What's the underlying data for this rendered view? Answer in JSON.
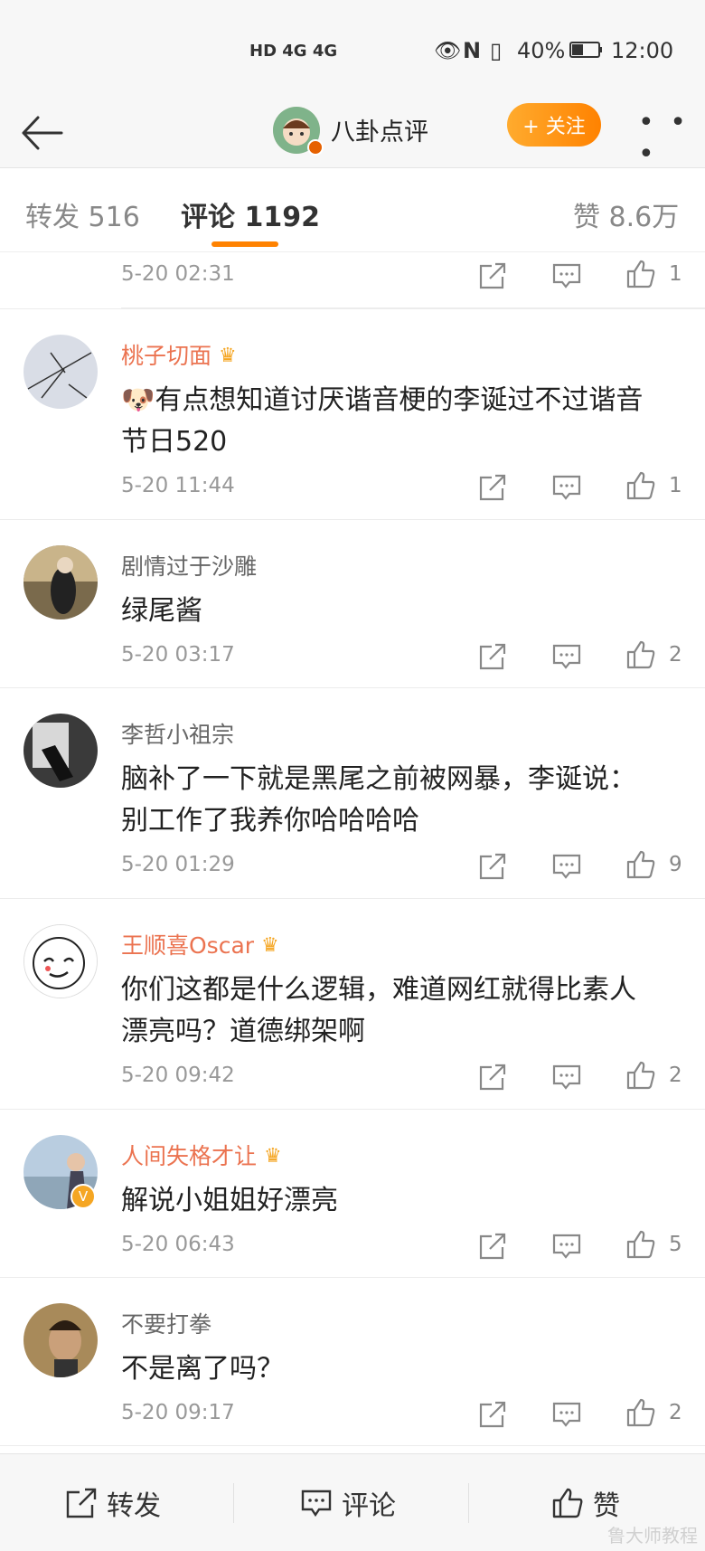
{
  "status_bar": {
    "network": "HD 4G 4G",
    "battery": "40%",
    "time": "12:00"
  },
  "header": {
    "account_name": "八卦点评",
    "follow_label": "+ 关注",
    "more_label": "• • •"
  },
  "tabs": {
    "repost": "转发 516",
    "comment": "评论 1192",
    "like": "赞 8.6万"
  },
  "partial_top": {
    "time": "5-20 02:31",
    "likes": "1"
  },
  "comments": [
    {
      "user": "桃子切面",
      "vip": true,
      "text1": "有点想知道讨厌谐音梗的李诞过不过谐音",
      "text2": "节日520",
      "emoji": "🐶",
      "time": "5-20 11:44",
      "likes": "1"
    },
    {
      "user": "剧情过于沙雕",
      "vip": false,
      "text1": "绿尾酱",
      "time": "5-20 03:17",
      "likes": "2"
    },
    {
      "user": "李哲小祖宗",
      "vip": false,
      "text1": "脑补了一下就是黑尾之前被网暴，李诞说：",
      "text2": "别工作了我养你哈哈哈哈",
      "time": "5-20 01:29",
      "likes": "9"
    },
    {
      "user": "王顺喜Oscar",
      "vip": true,
      "text1": "你们这都是什么逻辑，难道网红就得比素人",
      "text2": "漂亮吗？道德绑架啊",
      "time": "5-20 09:42",
      "likes": "2"
    },
    {
      "user": "人间失格才让",
      "vip": true,
      "verified": true,
      "text1": "解说小姐姐好漂亮",
      "time": "5-20 06:43",
      "likes": "5"
    },
    {
      "user": "不要打拳",
      "vip": false,
      "text1": "不是离了吗？",
      "time": "5-20 09:17",
      "likes": "2"
    }
  ],
  "bottom_bar": {
    "repost": "转发",
    "comment": "评论",
    "like": "赞"
  },
  "watermark": "鲁大师教程",
  "colors": {
    "accent": "#ff8200",
    "vip_name": "#eb7350"
  }
}
